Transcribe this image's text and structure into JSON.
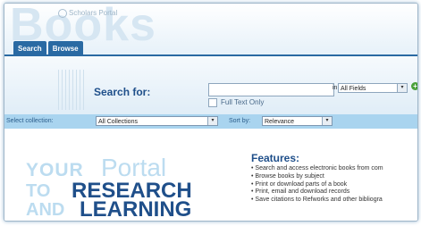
{
  "header": {
    "brand": "Scholars Portal",
    "logo_word": "Books",
    "tabs": [
      "Search",
      "Browse"
    ]
  },
  "search": {
    "label": "Search for:",
    "query_value": "",
    "in_label": "in",
    "field_selected": "All Fields",
    "full_text_only_label": "Full Text Only",
    "full_text_only_checked": false,
    "go_icon": "plus-circle-icon"
  },
  "collection": {
    "label": "Select collection:",
    "selected": "All Collections",
    "sort_label": "Sort by:",
    "sort_selected": "Relevance"
  },
  "hero": {
    "line1a": "YOUR",
    "line1b": "Portal",
    "line2a": "TO",
    "line2b": "RESEARCH",
    "line3a": "AND",
    "line3b": "LEARNING"
  },
  "features": {
    "title": "Features:",
    "items": [
      "Search and access electronic books from com",
      "Browse books by subject",
      "Print or download parts of a book",
      "Print, email and download records",
      "Save citations to Refworks and other bibliogra"
    ]
  },
  "colors": {
    "primary": "#2a6aa3",
    "heading": "#1f4f8a",
    "collection_bar": "#a9d4ef",
    "accent_light": "#bcdcf0",
    "go_green": "#4aa13a"
  }
}
